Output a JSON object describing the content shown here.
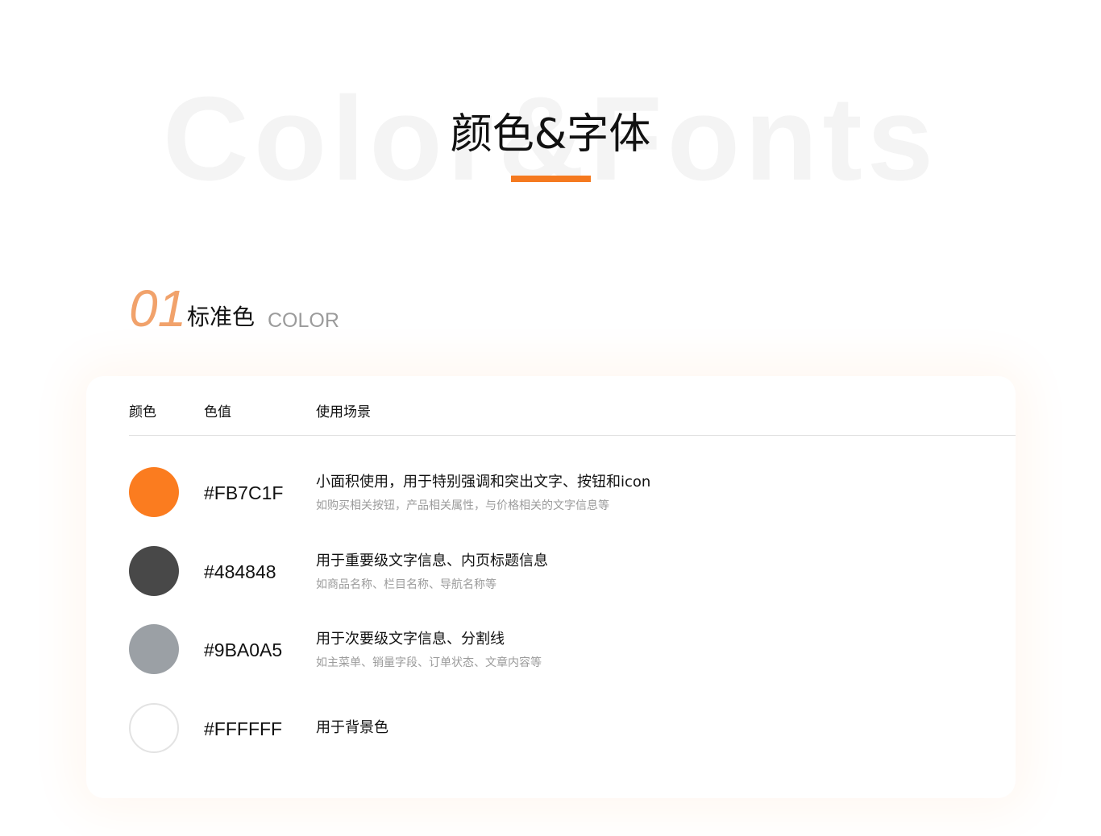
{
  "header": {
    "background_word": "Color&Fonts",
    "title": "颜色&字体",
    "accent_color": "#f5791f"
  },
  "section": {
    "number": "01",
    "title": "标准色",
    "subtitle": "COLOR",
    "number_color": "#f1a26b"
  },
  "table": {
    "columns": [
      "颜色",
      "色值",
      "使用场景"
    ],
    "rows": [
      {
        "color": "#FB7C1F",
        "value": "#FB7C1F",
        "usage": "小面积使用，用于特别强调和突出文字、按钮和icon",
        "note": "如购买相关按钮，产品相关属性，与价格相关的文字信息等"
      },
      {
        "color": "#484848",
        "value": "#484848",
        "usage": "用于重要级文字信息、内页标题信息",
        "note": "如商品名称、栏目名称、导航名称等"
      },
      {
        "color": "#9BA0A5",
        "value": "#9BA0A5",
        "usage": "用于次要级文字信息、分割线",
        "note": "如主菜单、销量字段、订单状态、文章内容等"
      },
      {
        "color": "#FFFFFF",
        "value": "#FFFFFF",
        "usage": "用于背景色",
        "note": ""
      }
    ]
  }
}
